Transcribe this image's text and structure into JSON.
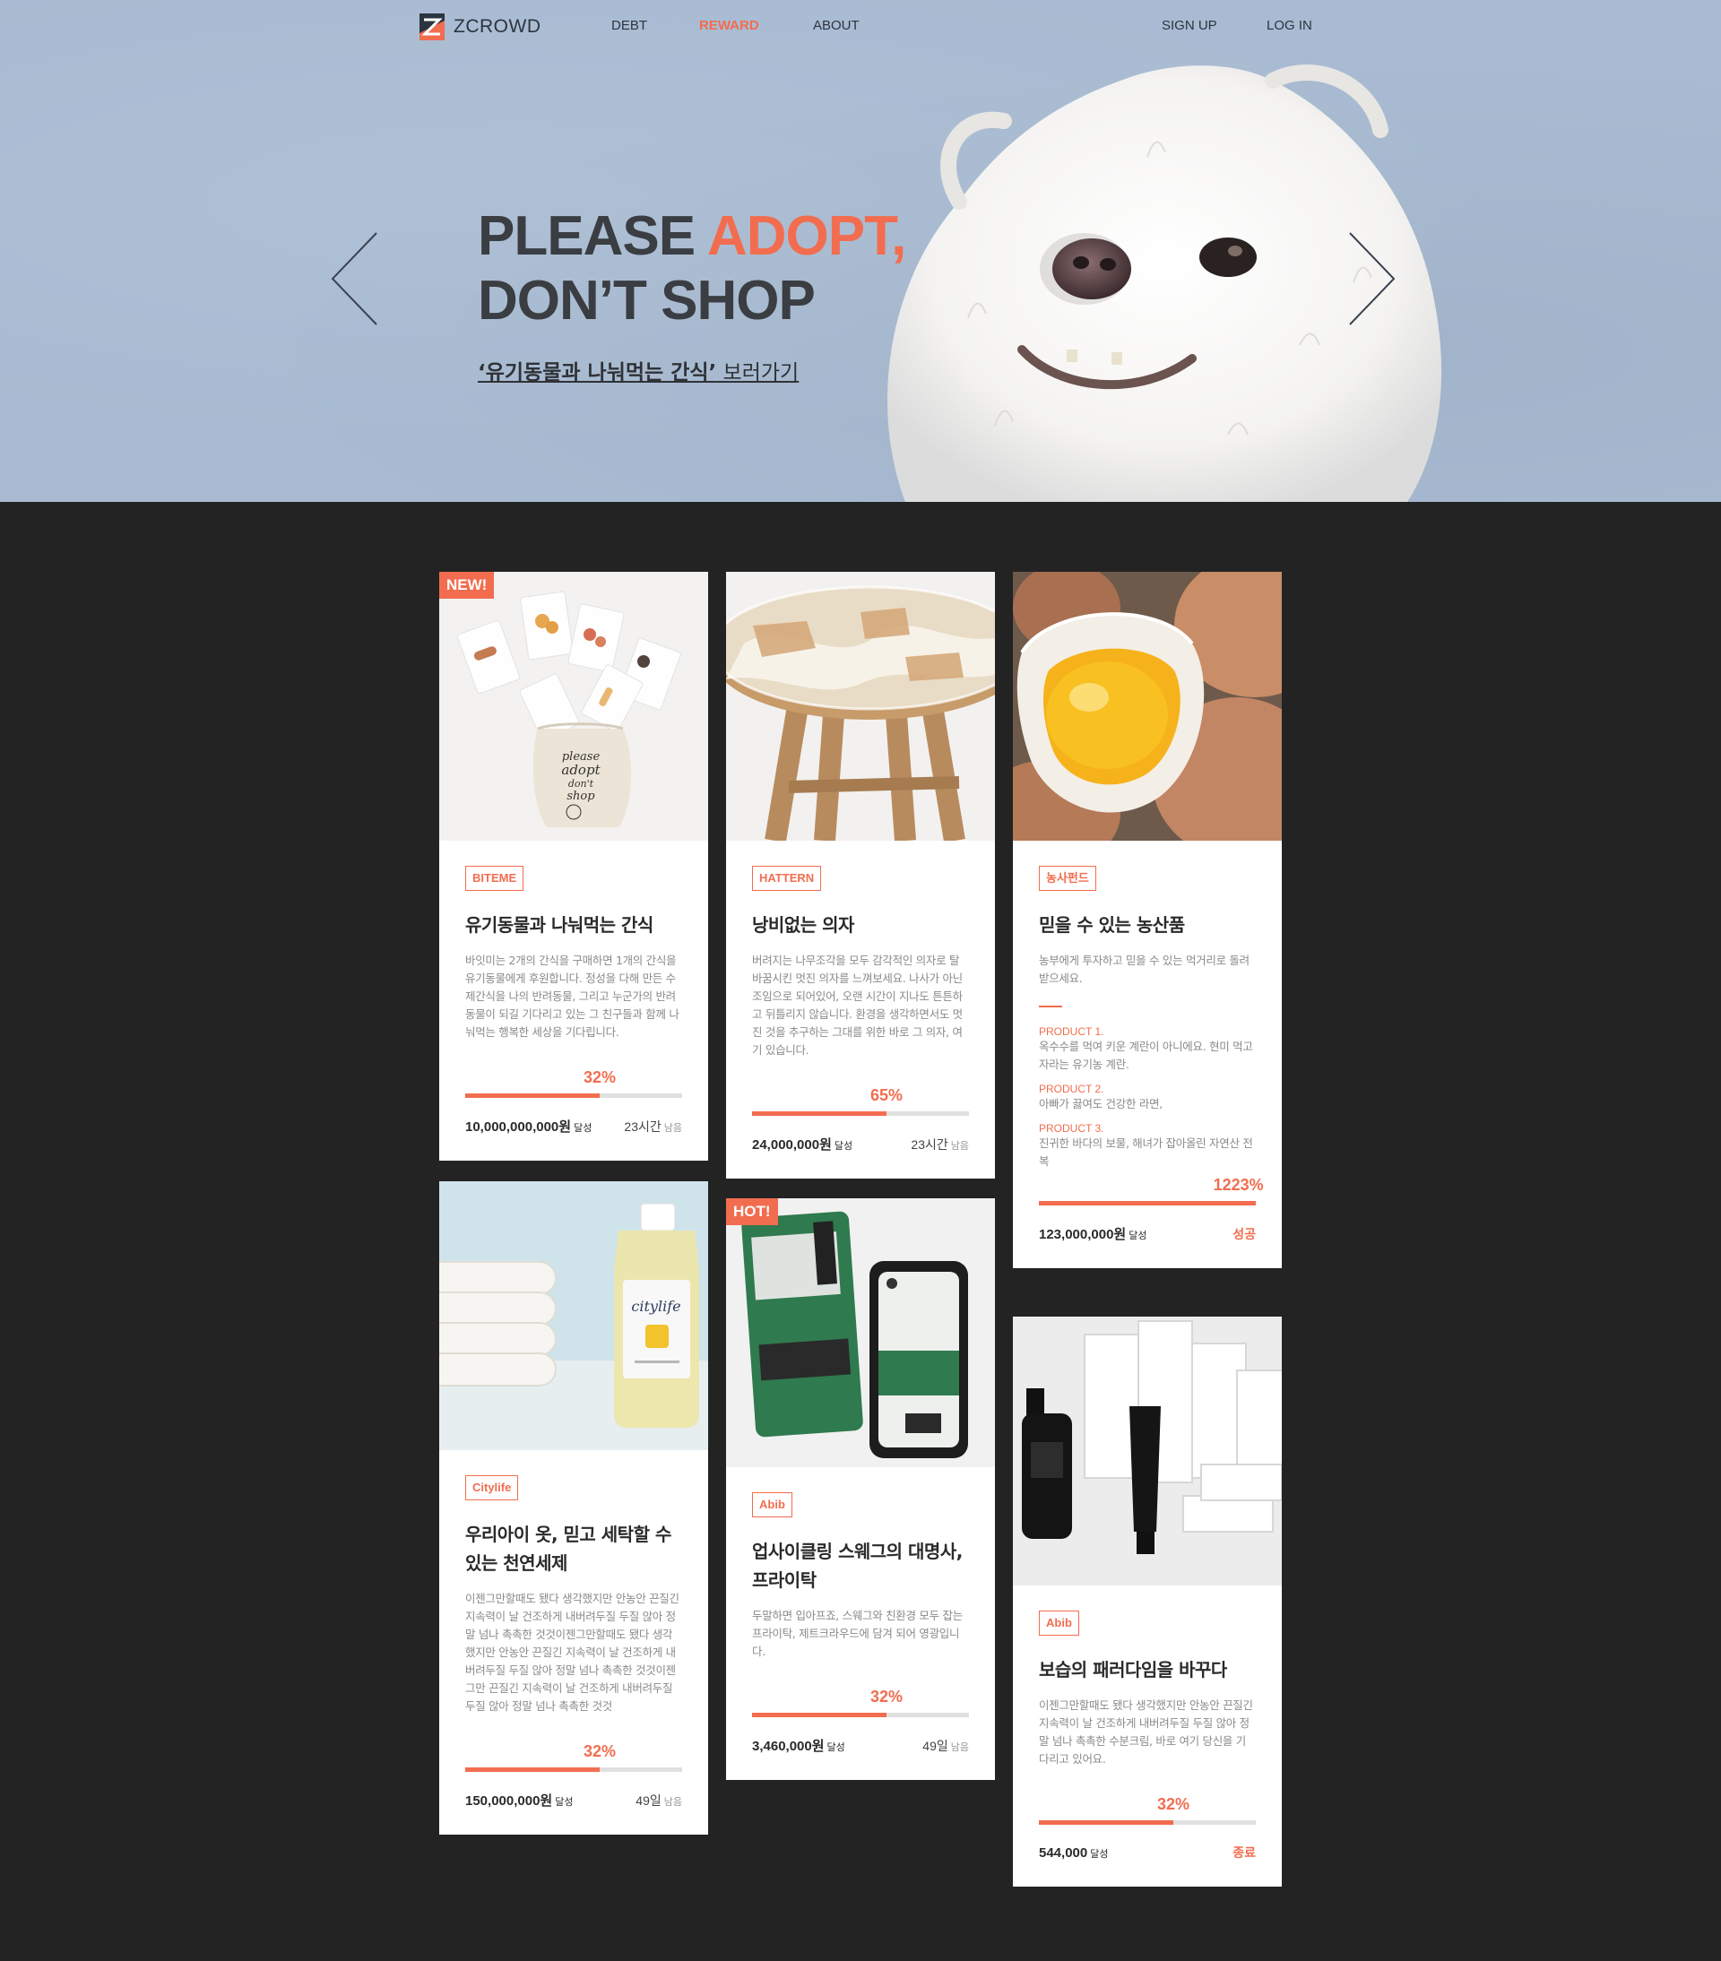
{
  "nav": {
    "logo": "ZCROWD",
    "links": [
      "DEBT",
      "REWARD",
      "ABOUT"
    ],
    "signup": "SIGN UP",
    "login": "LOG IN"
  },
  "hero": {
    "line1_a": "PLEASE ",
    "line1_b": "ADOPT,",
    "line2": "DON’T SHOP",
    "link_strong": "‘유기동물과 나눠먹는 간식’",
    "link_rest": " 보러가기"
  },
  "cards": [
    {
      "badge": "NEW!",
      "tag": "BITEME",
      "title": "유기동물과 나눠먹는 간식",
      "desc": "바잇미는 2개의 간식을 구매하면 1개의 간식을 유기동물에게 후원합니다. 정성을 다해 만든 수제간식을 나의 반려동물, 그리고 누군가의 반려동물이 되길 기다리고 있는 그 친구들과 함께 나눠먹는 행복한 세상을 기다립니다.",
      "percent_label": "32%",
      "progress": 0.62,
      "amount": "10,000,000,000원",
      "amount_unit": "달성",
      "remain": "23시간",
      "remain_unit": "남음"
    },
    {
      "tag": "HATTERN",
      "title": "낭비없는 의자",
      "desc": "버려지는 나무조각을 모두 감각적인 의자로 탈바꿈시킨 멋진 의자를 느껴보세요. 나사가 아닌 조임으로 되어있어, 오랜 시간이 지나도 튼튼하고 뒤틀리지 않습니다. 환경을 생각하면서도 멋진 것을 추구하는 그대를 위한 바로 그 의자, 여기 있습니다.",
      "percent_label": "65%",
      "progress": 0.62,
      "amount": "24,000,000원",
      "amount_unit": "달성",
      "remain": "23시간",
      "remain_unit": "남음"
    },
    {
      "tag": "농사펀드",
      "title": "믿을 수 있는 농산품",
      "desc": "농부에게 투자하고 믿을 수 있는 먹거리로 돌려받으세요.",
      "products": [
        {
          "label": "PRODUCT 1.",
          "text": "옥수수를 먹여 키운 계란이 아니에요. 현미 먹고 자라는 유기농 계란."
        },
        {
          "label": "PRODUCT 2.",
          "text": "아빠가 끓여도 건강한 라면,"
        },
        {
          "label": "PRODUCT 3.",
          "text": "진귀한 바다의 보물, 해녀가 잡아올린 자연산 전복"
        }
      ],
      "percent_label": "1223%",
      "progress": 1.0,
      "amount": "123,000,000원",
      "amount_unit": "달성",
      "status": "성공"
    },
    {
      "tag": "Citylife",
      "title": "우리아이 옷, 믿고 세탁할 수있는 천연세제",
      "desc": "이젠그만할때도 됐다 생각했지만 안농안 끈질긴 지속력이 날 건조하게 내버려두질 두질 않아 정말 넘나 촉촉한 것것이젠그만할때도 됐다 생각했지만 안농안 끈질긴 지속력이 날 건조하게 내버려두질 두질 않아 정말 넘나 촉촉한 것것이젠그만 끈질긴 지속력이 날 건조하게 내버려두질 두질 않아 정말 넘나 촉촉한 것것",
      "percent_label": "32%",
      "progress": 0.62,
      "amount": "150,000,000원",
      "amount_unit": "달성",
      "remain": "49일",
      "remain_unit": "남음"
    },
    {
      "badge": "HOT!",
      "tag": "Abib",
      "title": "업사이클링 스웨그의 대명사, 프라이탁",
      "desc": "두말하면 입아프죠, 스웨그와 친환경 모두 잡는 프라이탁, 제트크라우드에 담겨 되어 영광입니다.",
      "percent_label": "32%",
      "progress": 0.62,
      "amount": "3,460,000원",
      "amount_unit": "달성",
      "remain": "49일",
      "remain_unit": "남음"
    },
    {
      "tag": "Abib",
      "title": "보습의 패러다임을 바꾸다",
      "desc": "이젠그만할때도 됐다 생각했지만 안농안 끈질긴 지속력이 날 건조하게 내버려두질 두질 않아 정말 넘나 촉촉한 수분크림, 바로 여기 당신을 기다리고 있어요.",
      "percent_label": "32%",
      "progress": 0.62,
      "amount": "544,000",
      "amount_unit": "달성",
      "status": "종료"
    }
  ],
  "colors": {
    "accent": "#f26d4f",
    "hero_bg": "#a8bbd2",
    "page_bg": "#232323"
  },
  "icons": [
    "zcrowd-logo-icon",
    "chevron-left-icon",
    "chevron-right-icon"
  ]
}
